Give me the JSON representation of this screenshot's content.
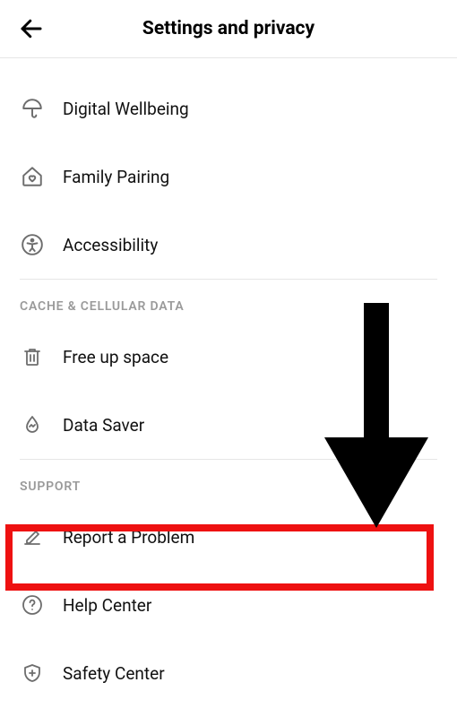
{
  "header": {
    "title": "Settings and privacy"
  },
  "sections": {
    "general": {
      "items": [
        {
          "label": "Digital Wellbeing"
        },
        {
          "label": "Family Pairing"
        },
        {
          "label": "Accessibility"
        }
      ]
    },
    "cache": {
      "title": "CACHE & CELLULAR DATA",
      "items": [
        {
          "label": "Free up space"
        },
        {
          "label": "Data Saver"
        }
      ]
    },
    "support": {
      "title": "SUPPORT",
      "items": [
        {
          "label": "Report a Problem"
        },
        {
          "label": "Help Center"
        },
        {
          "label": "Safety Center"
        }
      ]
    }
  }
}
